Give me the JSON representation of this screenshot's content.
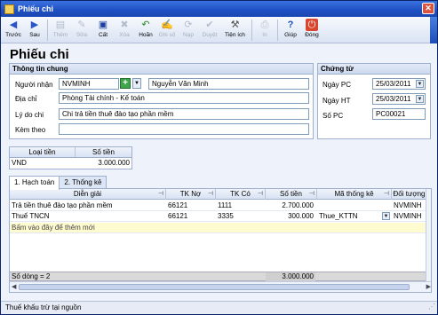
{
  "window": {
    "title": "Phiếu chi"
  },
  "toolbar": {
    "back": "Trước",
    "next": "Sau",
    "add": "Thêm",
    "edit": "Sửa",
    "save": "Cất",
    "delete": "Xóa",
    "undo": "Hoãn",
    "post": "Ghi số",
    "print": "Nạp",
    "unpost": "Duyệt",
    "utilities": "Tiện ích",
    "print2": "In",
    "help": "Giúp",
    "close": "Đóng"
  },
  "heading": "Phiếu chi",
  "general": {
    "title": "Thông tin chung",
    "receiver_label": "Người nhận",
    "receiver_code": "NVMINH",
    "receiver_name": "Nguyễn Văn Minh",
    "address_label": "Địa chỉ",
    "address": "Phòng Tài chính - Kế toán",
    "reason_label": "Lý do chi",
    "reason": "Chi trả tiền thuê đào tạo phần mềm",
    "attach_label": "Kèm theo",
    "attach": ""
  },
  "voucher": {
    "title": "Chứng từ",
    "pc_date_label": "Ngày PC",
    "pc_date": "25/03/2011",
    "ht_date_label": "Ngày HT",
    "ht_date": "25/03/2011",
    "number_label": "Số PC",
    "number": "PC00021"
  },
  "currency": {
    "headers": [
      "Loại tiền",
      "Số tiền"
    ],
    "row": [
      "VND",
      "3.000.000"
    ]
  },
  "tabs": [
    "1. Hạch toán",
    "2. Thống kê"
  ],
  "grid": {
    "headers": [
      "Diễn giải",
      "TK Nợ",
      "TK Có",
      "Số tiền",
      "Mã thống kê",
      "Đối tượng"
    ],
    "rows": [
      [
        "Trả tiền thuê đào tạo phần mềm",
        "66121",
        "1111",
        "2.700.000",
        "",
        "NVMINH"
      ],
      [
        "Thuế TNCN",
        "66121",
        "3335",
        "300.000",
        "Thue_KTTN",
        "NVMINH"
      ]
    ],
    "new_row": "Bấm vào đây để thêm mới",
    "footer_count": "Số dòng = 2",
    "footer_total": "3.000.000"
  },
  "status": "Thuế khấu trừ tại nguồn"
}
